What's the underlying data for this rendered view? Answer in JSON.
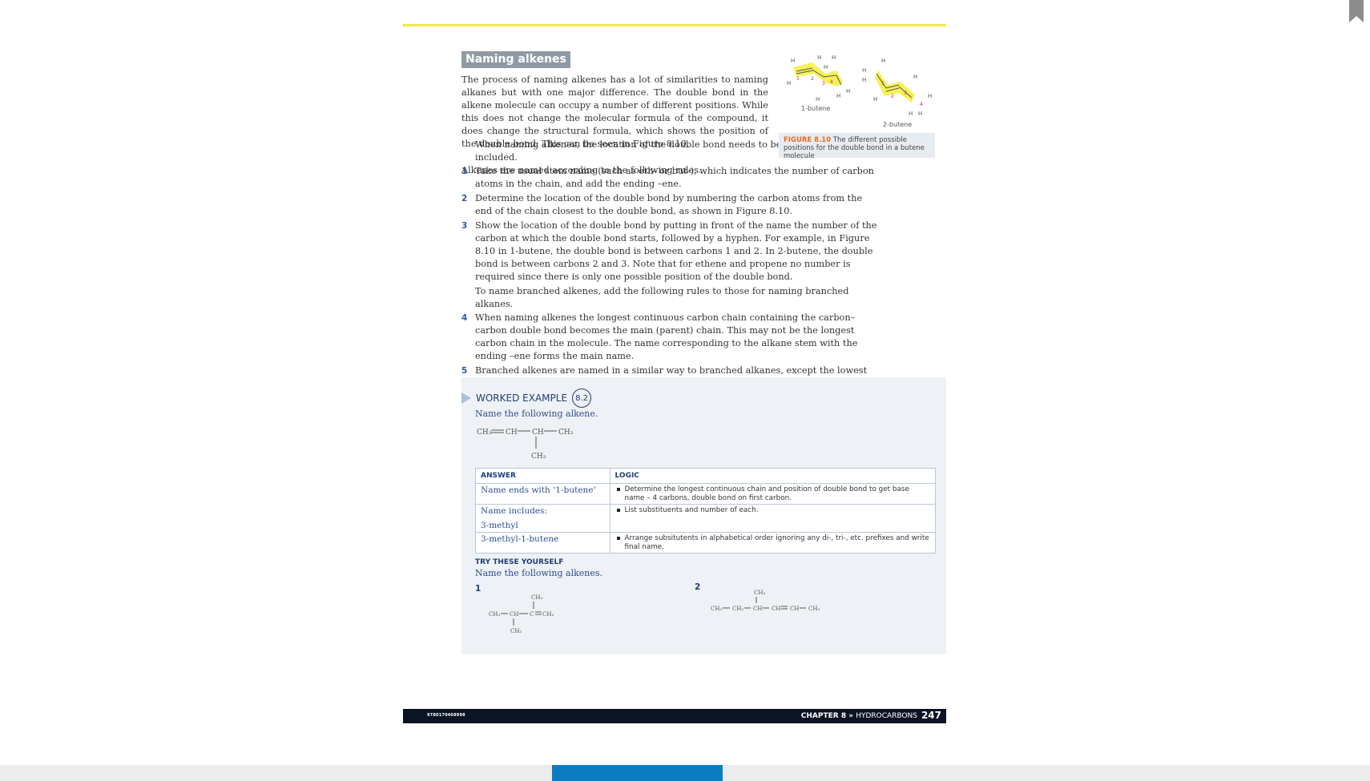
{
  "section": {
    "heading": "Naming alkenes",
    "para1": "The process of naming alkenes has a lot of similarities to naming alkanes but with one major difference. The double bond in the alkene molecule can occupy a number of different positions. While this does not change the molecular formula of the compound, it does change the structural formula, which shows the position of the double bond. This can be seen in Figure 8.10.",
    "para2_indent": "When naming alkenes, the location of the double bond needs to be included.",
    "para2_rest": "Alkenes are named according to the following rules.",
    "rules": [
      {
        "num": "1",
        "text": "Take the usual stem name (such as eth- or but-), which indicates the number of carbon atoms in the chain, and add the ending –ene."
      },
      {
        "num": "2",
        "text": "Determine the location of the double bond by numbering the carbon atoms from the end of the chain closest to the double bond, as shown in Figure 8.10."
      },
      {
        "num": "3",
        "text": "Show the location of the double bond by putting in front of the name the number of the carbon at which the double bond starts, followed by a hyphen. For example, in Figure 8.10 in 1-butene, the double bond is between carbons 1 and 2. In 2-butene, the double bond is between carbons 2 and 3. Note that for ethene and propene no number is required since there is only one possible position of the double bond."
      }
    ],
    "mid_para": "To name branched alkenes, add the following rules to those for naming branched alkanes.",
    "rules2": [
      {
        "num": "4",
        "text": "When naming alkenes the longest continuous carbon chain containing the carbon–carbon double bond becomes the main (parent) chain. This may not be the longest carbon chain in the molecule. The name corresponding to the alkane stem with the ending –ene forms the main name."
      },
      {
        "num": "5",
        "text": "Branched alkenes are named in a similar way to branched alkanes, except the lowest number is assigned to the double bond and not the substituent group."
      }
    ]
  },
  "figure": {
    "mol1_name": "1-butene",
    "mol2_name": "2-butene",
    "caption_label": "FIGURE 8.10",
    "caption_text": "The different possible positions for the double bond in a butene molecule",
    "atom_h": "H",
    "atom_c": "C",
    "num1": "1",
    "num2": "2",
    "num3": "3",
    "num4": "4"
  },
  "worked_example": {
    "title": "WORKED EXAMPLE",
    "number": "8.2",
    "question": "Name the following alkene.",
    "formula": {
      "ch3a": "CH₃",
      "ch": "CH",
      "ch3b": "CH₃",
      "ch3c": "CH₃"
    },
    "table": {
      "col1": "ANSWER",
      "col2": "LOGIC",
      "r1_answer": "Name ends with ‘1-butene’",
      "r1_logic": "Determine the longest continuous chain and position of double bond to get base name – 4 carbons, double bond on first carbon.",
      "r2_answer_a": "Name includes:",
      "r2_answer_b": "3-methyl",
      "r2_logic": "List substituents and number of each.",
      "r3_answer": "3-methyl-1-butene",
      "r3_logic": "Arrange subsitutents in alphabetical order ignoring any di-, tri-, etc. prefixes and write final name."
    },
    "try_heading": "TRY THESE YOURSELF",
    "try_sub": "Name the following alkenes.",
    "q1": "1",
    "q2": "2",
    "q1_formula": {
      "ch3": "CH₃",
      "ch": "CH",
      "c": "C",
      "ch2": "CH₂"
    },
    "q2_formula": {
      "ch3": "CH₃",
      "ch2": "CH₂",
      "ch": "CH"
    }
  },
  "footer": {
    "isbn": "9780170408998",
    "chapter": "CHAPTER 8",
    "sep": "»",
    "topic": "HYDROCARBONS",
    "page": "247"
  }
}
